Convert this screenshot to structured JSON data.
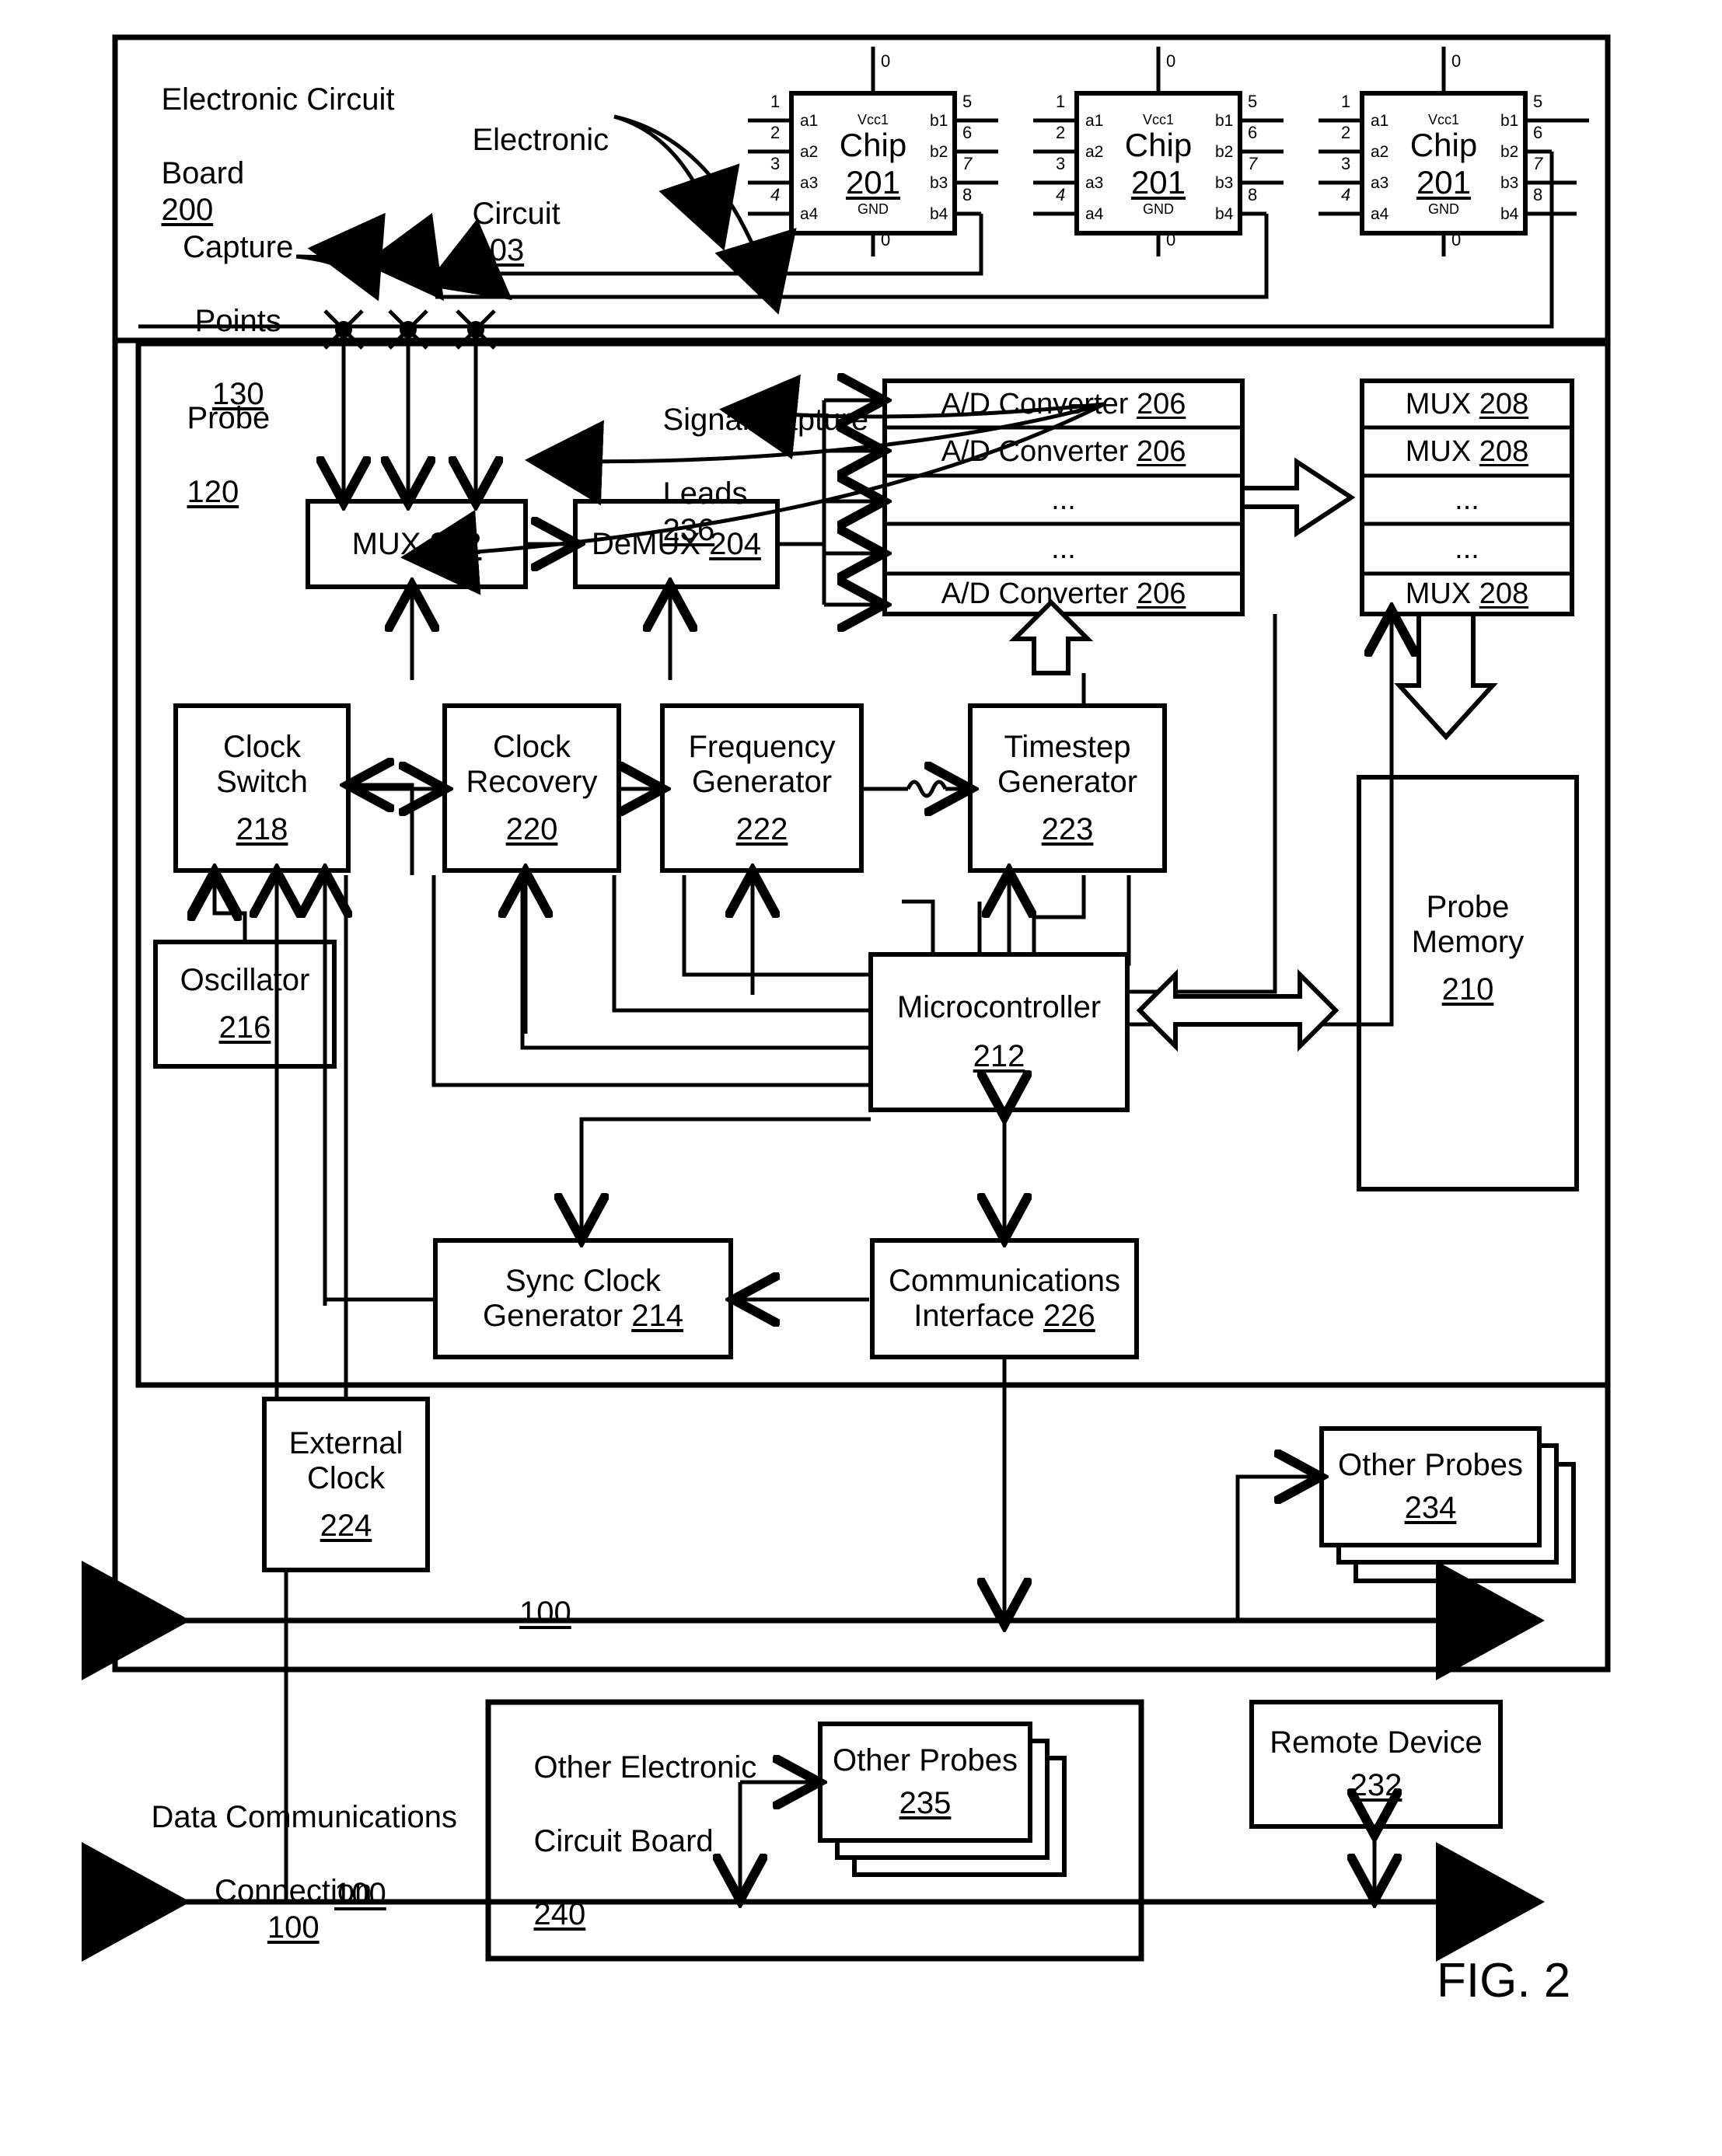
{
  "figure": {
    "caption": "FIG. 2"
  },
  "board": {
    "title_line1": "Electronic Circuit",
    "title_line2": "Board",
    "title_ref": "200",
    "circuit_label_line1": "Electronic",
    "circuit_label_line2": "Circuit",
    "circuit_ref": "203",
    "capture_points_line1": "Capture",
    "capture_points_line2": "Points",
    "capture_points_ref": "130"
  },
  "chips": [
    {
      "name": "Chip",
      "ref": "201",
      "vcc": "Vcc1",
      "gnd": "GND",
      "left_pin_names": [
        "a1",
        "a2",
        "a3",
        "a4"
      ],
      "right_pin_names": [
        "b1",
        "b2",
        "b3",
        "b4"
      ],
      "left_pin_numbers": [
        "1",
        "2",
        "3",
        "4"
      ],
      "right_pin_numbers": [
        "5",
        "6",
        "7",
        "8"
      ],
      "top_pin_number": "0",
      "bottom_pin_number": "0"
    },
    {
      "name": "Chip",
      "ref": "201",
      "vcc": "Vcc1",
      "gnd": "GND",
      "left_pin_names": [
        "a1",
        "a2",
        "a3",
        "a4"
      ],
      "right_pin_names": [
        "b1",
        "b2",
        "b3",
        "b4"
      ],
      "left_pin_numbers": [
        "1",
        "2",
        "3",
        "4"
      ],
      "right_pin_numbers": [
        "5",
        "6",
        "7",
        "8"
      ],
      "top_pin_number": "0",
      "bottom_pin_number": "0"
    },
    {
      "name": "Chip",
      "ref": "201",
      "vcc": "Vcc1",
      "gnd": "GND",
      "left_pin_names": [
        "a1",
        "a2",
        "a3",
        "a4"
      ],
      "right_pin_names": [
        "b1",
        "b2",
        "b3",
        "b4"
      ],
      "left_pin_numbers": [
        "1",
        "2",
        "3",
        "4"
      ],
      "right_pin_numbers": [
        "5",
        "6",
        "7",
        "8"
      ],
      "top_pin_number": "0",
      "bottom_pin_number": "0"
    }
  ],
  "probe": {
    "title": "Probe",
    "title_ref": "120",
    "signal_capture_leads_line1": "Signal Capture",
    "signal_capture_leads_line2": "Leads",
    "signal_capture_leads_ref": "236",
    "blocks": {
      "mux202": {
        "label": "MUX",
        "ref": "202"
      },
      "demux204": {
        "label": "DeMUX",
        "ref": "204"
      },
      "adc_stack": [
        {
          "label": "A/D Converter",
          "ref": "206"
        },
        {
          "label": "A/D Converter",
          "ref": "206"
        },
        {
          "label": "...",
          "ref": ""
        },
        {
          "label": "...",
          "ref": ""
        },
        {
          "label": "A/D Converter",
          "ref": "206"
        }
      ],
      "mux_stack": [
        {
          "label": "MUX",
          "ref": "208"
        },
        {
          "label": "MUX",
          "ref": "208"
        },
        {
          "label": "...",
          "ref": ""
        },
        {
          "label": "...",
          "ref": ""
        },
        {
          "label": "MUX",
          "ref": "208"
        }
      ],
      "clock_switch": {
        "line1": "Clock",
        "line2": "Switch",
        "ref": "218"
      },
      "clock_recovery": {
        "line1": "Clock",
        "line2": "Recovery",
        "ref": "220"
      },
      "frequency_generator": {
        "line1": "Frequency",
        "line2": "Generator",
        "ref": "222"
      },
      "timestep_generator": {
        "line1": "Timestep",
        "line2": "Generator",
        "ref": "223"
      },
      "oscillator": {
        "line1": "Oscillator",
        "ref": "216"
      },
      "microcontroller": {
        "line1": "Microcontroller",
        "ref": "212"
      },
      "probe_memory": {
        "line1": "Probe",
        "line2": "Memory",
        "ref": "210"
      },
      "sync_clock_generator": {
        "line1": "Sync Clock",
        "line2": "Generator",
        "ref": "214"
      },
      "communications_interface": {
        "line1": "Communications",
        "line2": "Interface",
        "ref": "226"
      }
    }
  },
  "external": {
    "external_clock": {
      "line1": "External",
      "line2": "Clock",
      "ref": "224"
    },
    "other_probes_234": {
      "line1": "Other Probes",
      "ref": "234"
    },
    "other_probes_235": {
      "line1": "Other Probes",
      "ref": "235"
    },
    "other_board": {
      "line1": "Other Electronic",
      "line2": "Circuit Board",
      "ref": "240"
    },
    "remote_device": {
      "line1": "Remote Device",
      "ref": "232"
    }
  },
  "bus": {
    "top_ref": "100",
    "bottom_ref": "100",
    "connection_line1": "Data Communications",
    "connection_line2": "Connection",
    "connection_ref": "100"
  }
}
